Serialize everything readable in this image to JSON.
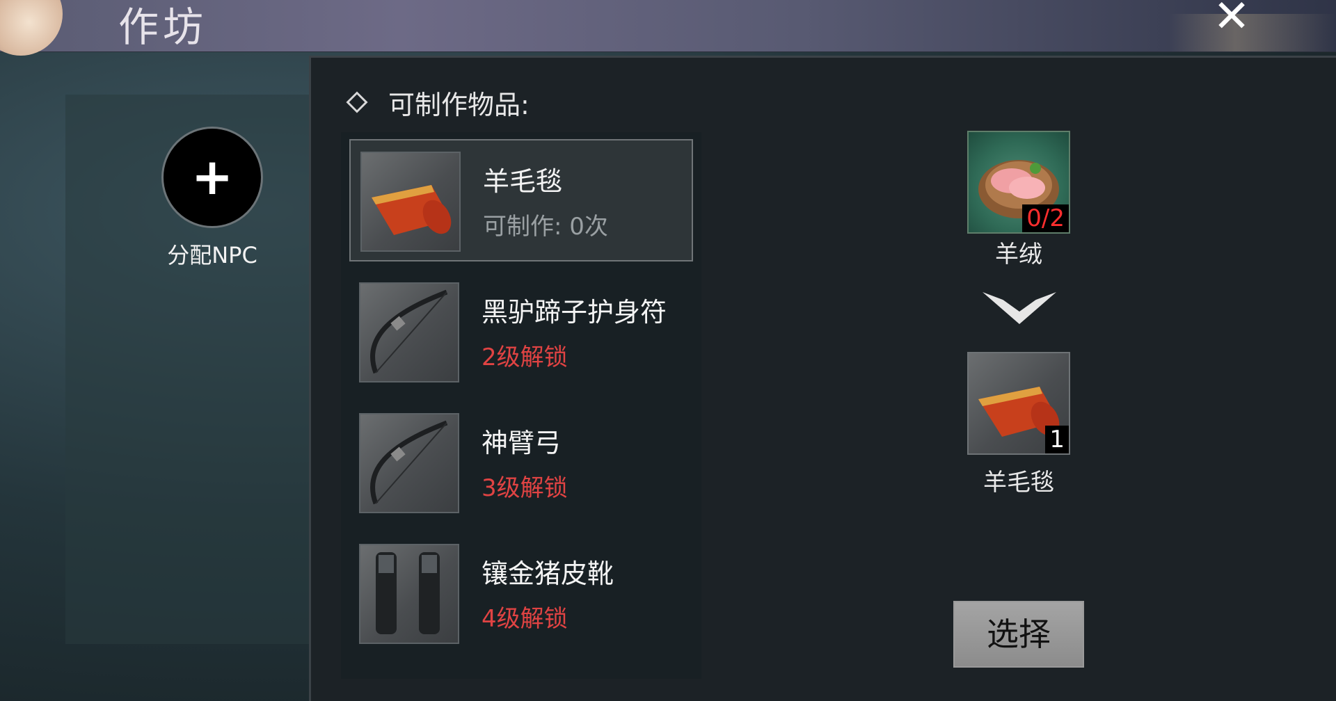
{
  "header": {
    "title": "作坊",
    "close_symbol": "✕"
  },
  "npc": {
    "add_symbol": "+",
    "label": "分配NPC"
  },
  "list": {
    "header": "可制作物品:",
    "items": [
      {
        "name": "羊毛毯",
        "sub": "可制作: 0次",
        "sub_color": "gray",
        "icon": "wool-blanket-icon",
        "selected": true
      },
      {
        "name": "黑驴蹄子护身符",
        "sub": "2级解锁",
        "sub_color": "red",
        "icon": "bow-icon",
        "selected": false
      },
      {
        "name": "神臂弓",
        "sub": "3级解锁",
        "sub_color": "red",
        "icon": "bow-icon",
        "selected": false
      },
      {
        "name": "镶金猪皮靴",
        "sub": "4级解锁",
        "sub_color": "red",
        "icon": "boots-icon",
        "selected": false
      }
    ]
  },
  "recipe": {
    "material": {
      "name": "羊绒",
      "count": "0/2",
      "icon": "raw-meat-plate-icon"
    },
    "output": {
      "name": "羊毛毯",
      "count": "1",
      "icon": "wool-blanket-icon"
    },
    "select_label": "选择"
  },
  "colors": {
    "sub_red": "#e04343",
    "count_red": "#ff2e2e"
  }
}
